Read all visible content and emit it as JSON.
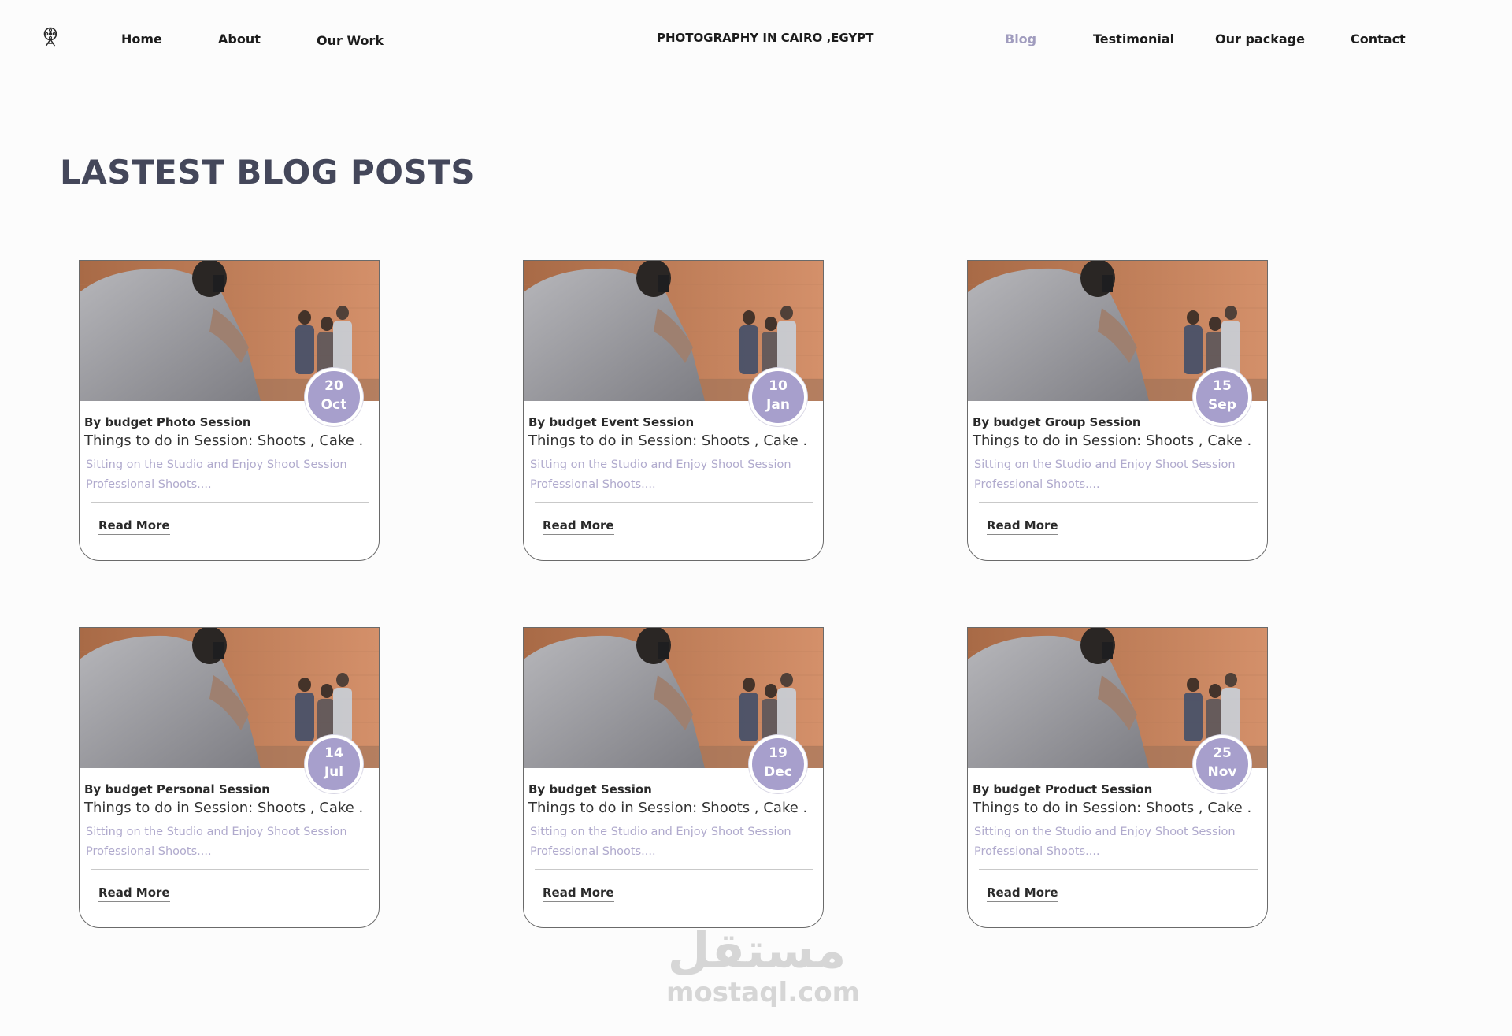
{
  "nav": {
    "left_links": [
      "Home",
      "About",
      "Our Work"
    ],
    "site_title": "PHOTOGRAPHY IN CAIRO ,EGYPT",
    "right_links": [
      "Blog",
      "Testimonial",
      "Our package",
      "Contact"
    ],
    "active": "Blog",
    "logo_icon": "camera-reel-icon"
  },
  "section": {
    "title": "LASTEST BLOG POSTS"
  },
  "posts": [
    {
      "day": "20",
      "month": "Oct",
      "author": "By budget Photo Session",
      "title": "Things to do in Session: Shoots , Cake .",
      "excerpt": "Sitting on the Studio and Enjoy Shoot Session Professional Shoots....",
      "cta": "Read More"
    },
    {
      "day": "10",
      "month": "Jan",
      "author": "By budget Event Session",
      "title": "Things to do in Session: Shoots , Cake .",
      "excerpt": "Sitting on the Studio and Enjoy Shoot Session Professional Shoots....",
      "cta": "Read More"
    },
    {
      "day": "15",
      "month": "Sep",
      "author": "By budget Group Session",
      "title": "Things to do in Session: Shoots , Cake .",
      "excerpt": "Sitting on the Studio and Enjoy Shoot Session Professional Shoots....",
      "cta": "Read More"
    },
    {
      "day": "14",
      "month": "Jul",
      "author": "By budget Personal Session",
      "title": "Things to do in Session: Shoots , Cake .",
      "excerpt": "Sitting on the Studio and Enjoy Shoot Session Professional Shoots....",
      "cta": "Read More"
    },
    {
      "day": "19",
      "month": "Dec",
      "author": "By budget Session",
      "title": "Things to do in Session: Shoots , Cake .",
      "excerpt": "Sitting on the Studio and Enjoy Shoot Session Professional Shoots....",
      "cta": "Read More"
    },
    {
      "day": "25",
      "month": "Nov",
      "author": "By budget Product Session",
      "title": "Things to do in Session: Shoots , Cake .",
      "excerpt": "Sitting on the Studio and Enjoy Shoot Session Professional Shoots....",
      "cta": "Read More"
    }
  ],
  "watermark": {
    "arabic": "مستقل",
    "latin": "mostaql.com"
  },
  "colors": {
    "accent": "#a79fcc",
    "active_nav": "#a09cbe",
    "heading": "#44475a",
    "excerpt": "#b0aacd"
  }
}
